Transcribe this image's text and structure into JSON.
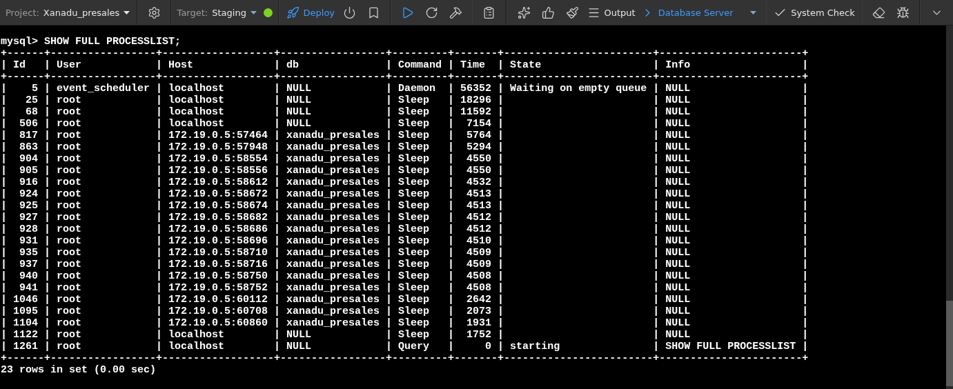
{
  "toolbar": {
    "project_label": "Project:",
    "project": "Xanadu_presales",
    "target_label": "Target:",
    "target": "Staging",
    "deploy": "Deploy",
    "output": "Output",
    "server": "Database Server",
    "system_check": "System Check"
  },
  "terminal": {
    "lines": [
      "mysql> SHOW FULL PROCESSLIST;",
      "+------+-----------------+------------------+-----------------+---------+-------+------------------------+-----------------------+",
      "| Id   | User            | Host             | db              | Command | Time  | State                  | Info                  |",
      "+------+-----------------+------------------+-----------------+---------+-------+------------------------+-----------------------+",
      "|    5 | event_scheduler | localhost        | NULL            | Daemon  | 56352 | Waiting on empty queue | NULL                  |",
      "|   25 | root            | localhost        | NULL            | Sleep   | 18296 |                        | NULL                  |",
      "|   68 | root            | localhost        | NULL            | Sleep   | 11592 |                        | NULL                  |",
      "|  506 | root            | localhost        | NULL            | Sleep   |  7154 |                        | NULL                  |",
      "|  817 | root            | 172.19.0.5:57464 | xanadu_presales | Sleep   |  5764 |                        | NULL                  |",
      "|  863 | root            | 172.19.0.5:57948 | xanadu_presales | Sleep   |  5294 |                        | NULL                  |",
      "|  904 | root            | 172.19.0.5:58554 | xanadu_presales | Sleep   |  4550 |                        | NULL                  |",
      "|  905 | root            | 172.19.0.5:58556 | xanadu_presales | Sleep   |  4550 |                        | NULL                  |",
      "|  916 | root            | 172.19.0.5:58612 | xanadu_presales | Sleep   |  4532 |                        | NULL                  |",
      "|  924 | root            | 172.19.0.5:58672 | xanadu_presales | Sleep   |  4513 |                        | NULL                  |",
      "|  925 | root            | 172.19.0.5:58674 | xanadu_presales | Sleep   |  4513 |                        | NULL                  |",
      "|  927 | root            | 172.19.0.5:58682 | xanadu_presales | Sleep   |  4512 |                        | NULL                  |",
      "|  928 | root            | 172.19.0.5:58686 | xanadu_presales | Sleep   |  4512 |                        | NULL                  |",
      "|  931 | root            | 172.19.0.5:58696 | xanadu_presales | Sleep   |  4510 |                        | NULL                  |",
      "|  935 | root            | 172.19.0.5:58710 | xanadu_presales | Sleep   |  4509 |                        | NULL                  |",
      "|  937 | root            | 172.19.0.5:58716 | xanadu_presales | Sleep   |  4509 |                        | NULL                  |",
      "|  940 | root            | 172.19.0.5:58750 | xanadu_presales | Sleep   |  4508 |                        | NULL                  |",
      "|  941 | root            | 172.19.0.5:58752 | xanadu_presales | Sleep   |  4508 |                        | NULL                  |",
      "| 1046 | root            | 172.19.0.5:60112 | xanadu_presales | Sleep   |  2642 |                        | NULL                  |",
      "| 1095 | root            | 172.19.0.5:60708 | xanadu_presales | Sleep   |  2073 |                        | NULL                  |",
      "| 1104 | root            | 172.19.0.5:60860 | xanadu_presales | Sleep   |  1931 |                        | NULL                  |",
      "| 1122 | root            | localhost        | NULL            | Sleep   |  1752 |                        | NULL                  |",
      "| 1261 | root            | localhost        | NULL            | Query   |     0 | starting               | SHOW FULL PROCESSLIST |",
      "+------+-----------------+------------------+-----------------+---------+-------+------------------------+-----------------------+",
      "23 rows in set (0.00 sec)"
    ]
  }
}
